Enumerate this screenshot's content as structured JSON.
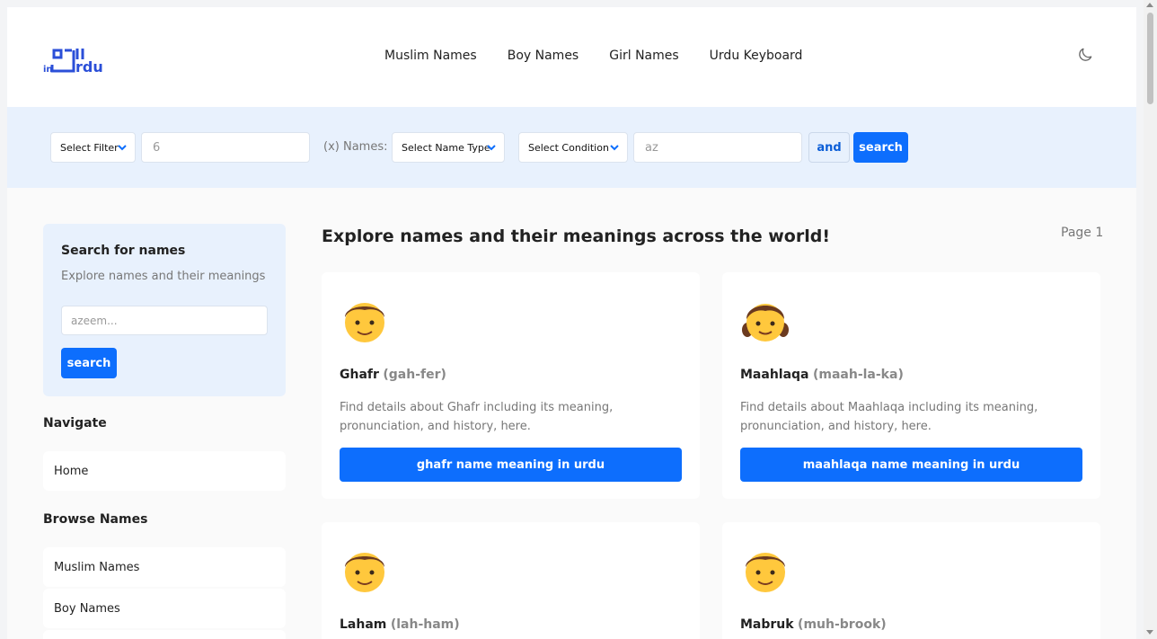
{
  "header": {
    "logo_text": "in Urdu",
    "nav": [
      "Muslim Names",
      "Boy Names",
      "Girl Names",
      "Urdu Keyboard"
    ],
    "theme_icon": "moon-icon"
  },
  "filter": {
    "select_filter": "Select Filter",
    "count_value": "6",
    "names_label": "(x) Names:",
    "name_type": "Select Name Type",
    "condition": "Select Condition",
    "condition_value": "az",
    "and_label": "and",
    "search_label": "search"
  },
  "sidebar": {
    "search_title": "Search for names",
    "search_sub": "Explore names and their meanings",
    "search_placeholder": "azeem...",
    "search_button": "search",
    "navigate_title": "Navigate",
    "navigate_items": [
      "Home"
    ],
    "browse_title": "Browse Names",
    "browse_items": [
      "Muslim Names",
      "Boy Names"
    ]
  },
  "main": {
    "title": "Explore names and their meanings across the world!",
    "page": "Page 1",
    "cards": [
      {
        "emoji": "👦",
        "name": "Ghafr",
        "pron": "(gah-fer)",
        "desc": "Find details about Ghafr including its meaning, pronunciation, and history, here.",
        "cta": "ghafr name meaning in urdu"
      },
      {
        "emoji": "👧",
        "name": "Maahlaqa",
        "pron": "(maah-la-ka)",
        "desc": "Find details about Maahlaqa including its meaning, pronunciation, and history, here.",
        "cta": "maahlaqa name meaning in urdu"
      },
      {
        "emoji": "👦",
        "name": "Laham",
        "pron": "(lah-ham)"
      },
      {
        "emoji": "👦",
        "name": "Mabruk",
        "pron": "(muh-brook)"
      }
    ]
  },
  "colors": {
    "accent": "#0d6efd",
    "filter_bg": "#e8f1fd"
  }
}
